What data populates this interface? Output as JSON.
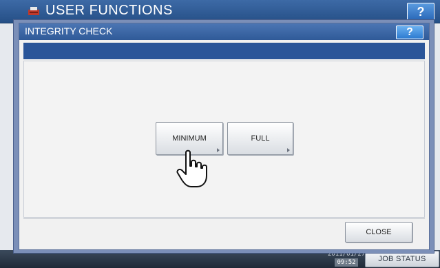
{
  "background": {
    "title": "USER FUNCTIONS",
    "help_label": "?",
    "footer": {
      "date": "2011/01/27",
      "time": "09:52",
      "job_status_label": "JOB STATUS"
    }
  },
  "dialog": {
    "title": "INTEGRITY CHECK",
    "help_label": "?",
    "buttons": {
      "minimum": "MINIMUM",
      "full": "FULL",
      "close": "CLOSE"
    }
  },
  "icons": {
    "logo": "printer-logo-icon",
    "cursor": "hand-pointer-icon"
  },
  "colors": {
    "header_blue": "#2f5a98",
    "dialog_frame": "#7b8fb8",
    "subbar_blue": "#2a5599"
  }
}
